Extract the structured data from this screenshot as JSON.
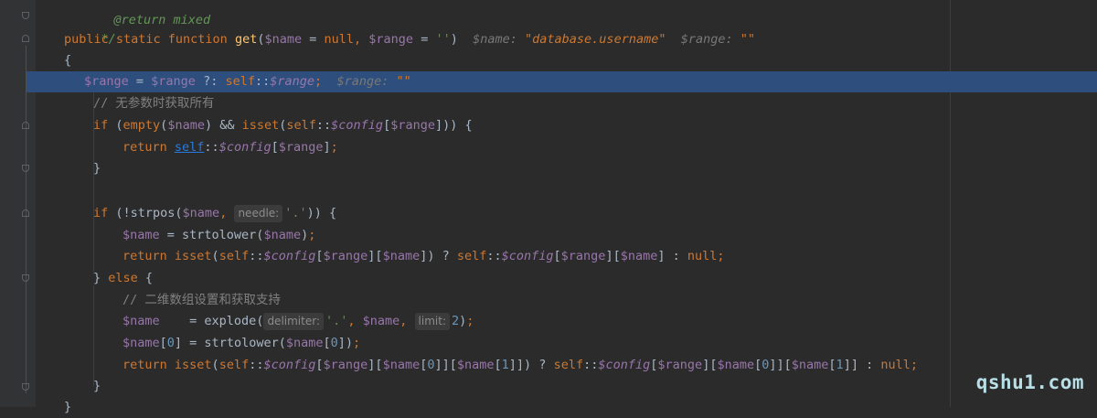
{
  "lines": {
    "l0": "@return mixed",
    "l1": "*/",
    "l2_kw": "public static function ",
    "l2_fn": "get",
    "l2_p1": "(",
    "l2_v1": "$name",
    "l2_eq1": " = ",
    "l2_null": "null",
    "l2_comma": ", ",
    "l2_v2": "$range",
    "l2_eq2": " = ",
    "l2_str": "''",
    "l2_p2": ")",
    "l2_hint1": "$name: ",
    "l2_hint1v": "\"database.username\"",
    "l2_hint2": "$range: ",
    "l2_hint2v": "\"\"",
    "l3": "{",
    "l4_a": "$range",
    "l4_b": " = ",
    "l4_c": "$range",
    "l4_d": " ?: ",
    "l4_e": "self",
    "l4_f": "::",
    "l4_g": "$range",
    "l4_h": ";",
    "l4_hint": "$range: ",
    "l4_hintv": "\"\"",
    "l5": "// 无参数时获取所有",
    "l6_if": "if ",
    "l6_a": "(",
    "l6_empty": "empty",
    "l6_b": "(",
    "l6_v1": "$name",
    "l6_c": ") && ",
    "l6_isset": "isset",
    "l6_d": "(",
    "l6_self": "self",
    "l6_e": "::",
    "l6_config": "$config",
    "l6_f": "[",
    "l6_v2": "$range",
    "l6_g": "])) {",
    "l7_ret": "return ",
    "l7_self": "self",
    "l7_a": "::",
    "l7_config": "$config",
    "l7_b": "[",
    "l7_v": "$range",
    "l7_c": "]",
    "l7_d": ";",
    "l8": "}",
    "l10_if": "if ",
    "l10_a": "(!strpos(",
    "l10_v": "$name",
    "l10_b": ", ",
    "l10_chip": "needle:",
    "l10_str": "'.'",
    "l10_c": ")) {",
    "l11_v": "$name",
    "l11_a": " = strtolower(",
    "l11_v2": "$name",
    "l11_b": ")",
    "l11_c": ";",
    "l12_ret": "return ",
    "l12_isset": "isset",
    "l12_a": "(",
    "l12_self": "self",
    "l12_b": "::",
    "l12_config": "$config",
    "l12_c": "[",
    "l12_v1": "$range",
    "l12_d": "][",
    "l12_v2": "$name",
    "l12_e": "]) ? ",
    "l12_self2": "self",
    "l12_f": "::",
    "l12_config2": "$config",
    "l12_g": "[",
    "l12_v3": "$range",
    "l12_h": "][",
    "l12_v4": "$name",
    "l12_i": "] : ",
    "l12_null": "null",
    "l12_j": ";",
    "l13_a": "} ",
    "l13_else": "else",
    "l13_b": " {",
    "l14": "// 二维数组设置和获取支持",
    "l15_v": "$name",
    "l15_a": "    = explode(",
    "l15_chip1": "delimiter:",
    "l15_str": "'.'",
    "l15_b": ", ",
    "l15_v2": "$name",
    "l15_c": ", ",
    "l15_chip2": "limit:",
    "l15_num": "2",
    "l15_d": ")",
    "l15_e": ";",
    "l16_v": "$name",
    "l16_a": "[",
    "l16_n": "0",
    "l16_b": "] = strtolower(",
    "l16_v2": "$name",
    "l16_c": "[",
    "l16_n2": "0",
    "l16_d": "])",
    "l16_e": ";",
    "l17_ret": "return ",
    "l17_isset": "isset",
    "l17_a": "(",
    "l17_self": "self",
    "l17_b": "::",
    "l17_config": "$config",
    "l17_c": "[",
    "l17_v1": "$range",
    "l17_d": "][",
    "l17_v2": "$name",
    "l17_e": "[",
    "l17_n1": "0",
    "l17_f": "]][",
    "l17_v3": "$name",
    "l17_g": "[",
    "l17_n2": "1",
    "l17_h": "]]) ? ",
    "l17_self2": "self",
    "l17_i": "::",
    "l17_config2": "$config",
    "l17_j": "[",
    "l17_v4": "$range",
    "l17_k": "][",
    "l17_v5": "$name",
    "l17_l": "[",
    "l17_n3": "0",
    "l17_m": "]][",
    "l17_v6": "$name",
    "l17_o": "[",
    "l17_n4": "1",
    "l17_p": "]] : ",
    "l17_null": "null",
    "l17_q": ";",
    "l18": "}",
    "l19": "}"
  },
  "watermark": "qshu1.com",
  "colors": {
    "background": "#2b2b2b",
    "highlight": "#2e4f7e",
    "keyword": "#cc7832",
    "function": "#ffc66d",
    "variable": "#9876aa",
    "string": "#6a8759",
    "comment": "#808080"
  }
}
